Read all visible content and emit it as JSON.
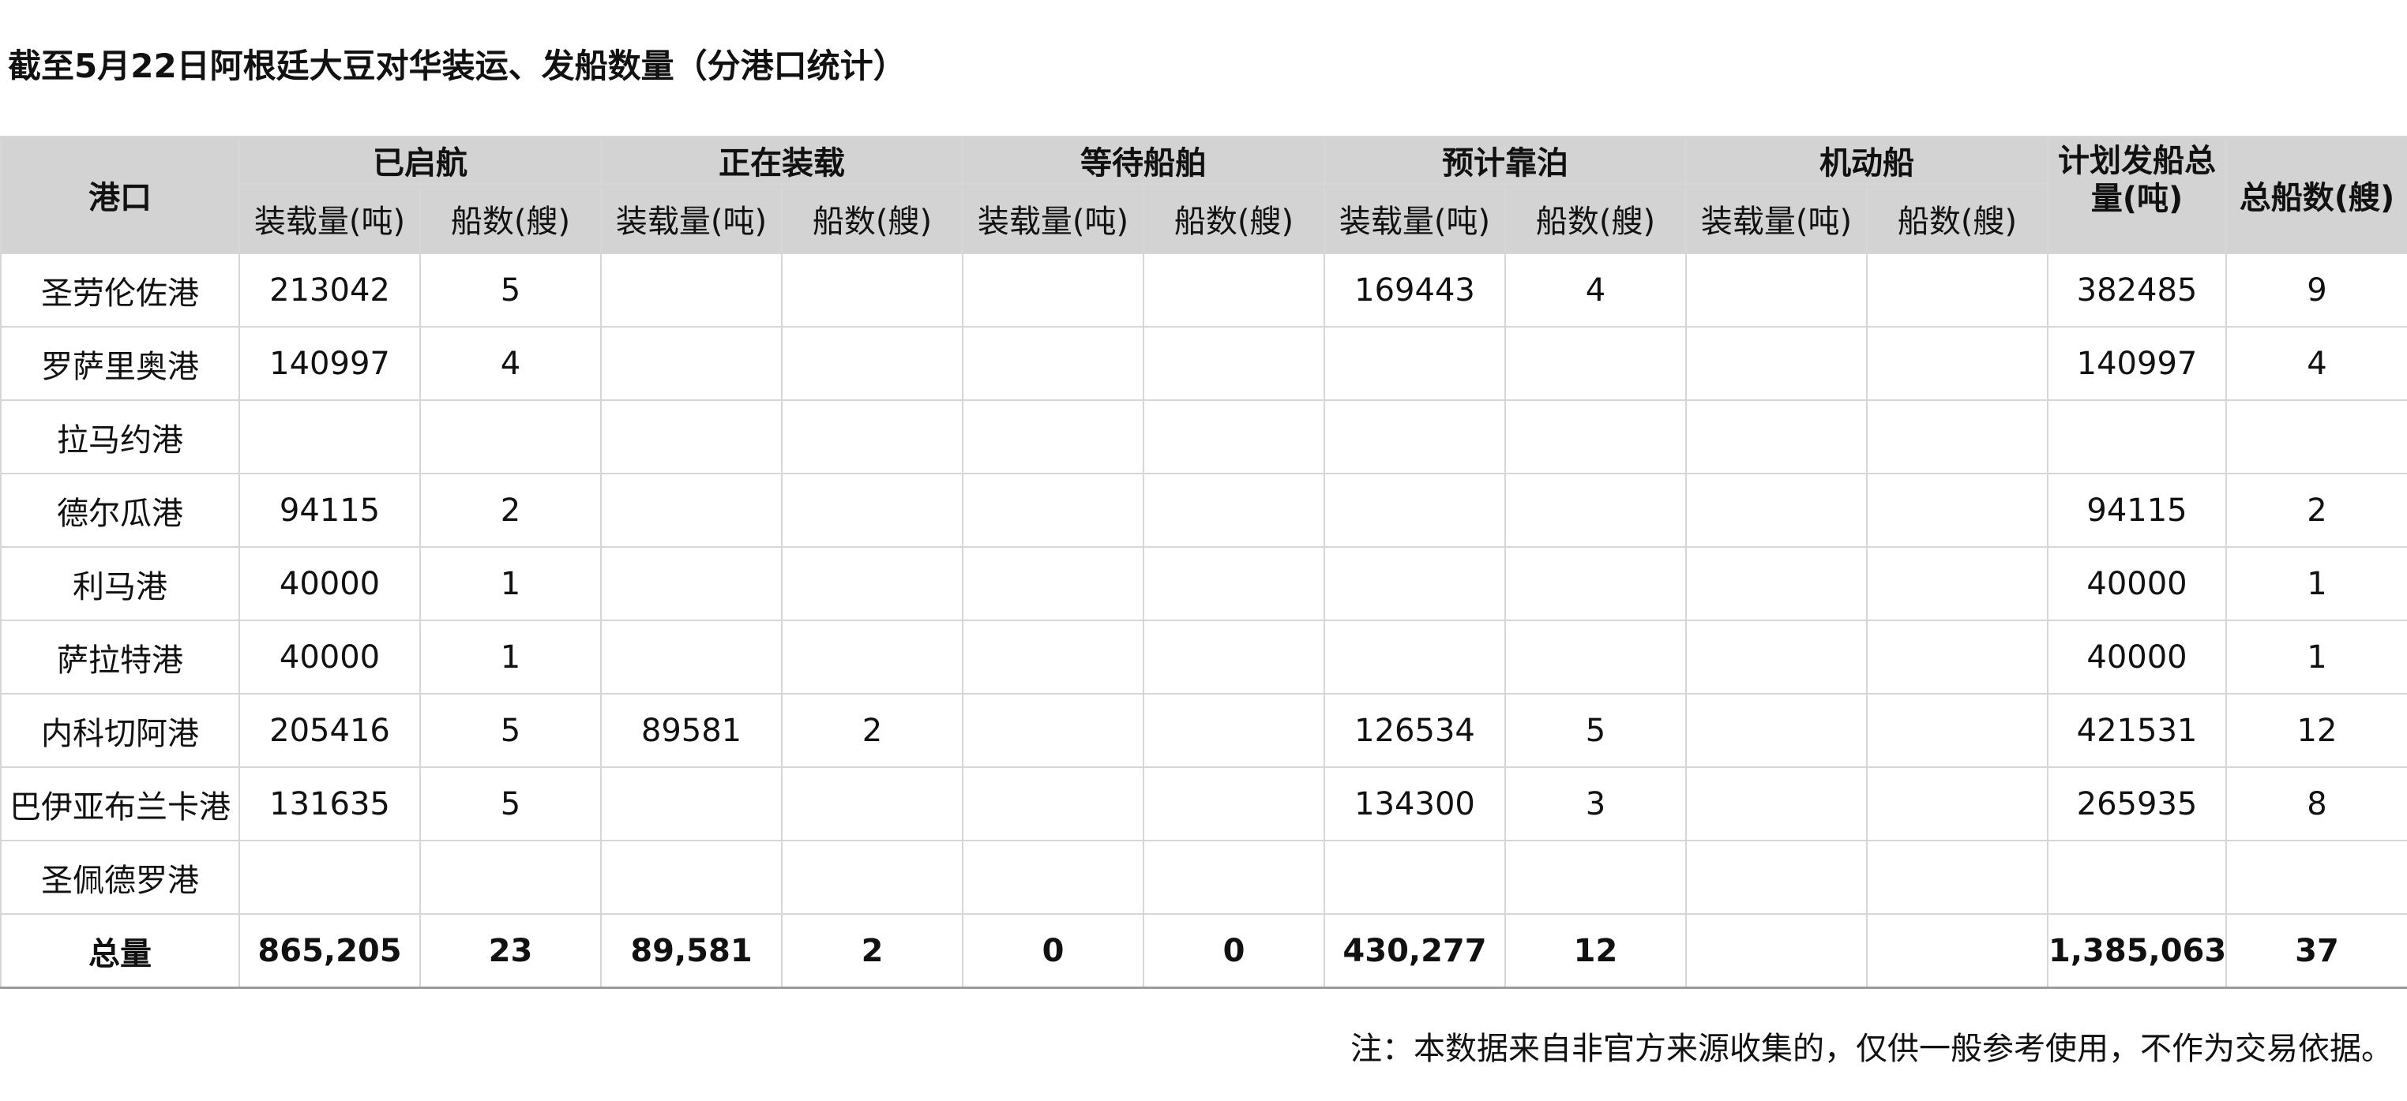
{
  "title": "截至5月22日阿根廷大豆对华装运、发船数量（分港口统计）",
  "headers": {
    "port": "港口",
    "groups": [
      "已启航",
      "正在装载",
      "等待船舶",
      "预计靠泊",
      "机动船"
    ],
    "planned": "计划发船总量(吨)",
    "total_ships": "总船数(艘)",
    "sub_tons": "装载量(吨)",
    "sub_ships": "船数(艘)"
  },
  "rows": [
    {
      "port": "圣劳伦佐港",
      "c": [
        "213042",
        "5",
        "",
        "",
        "",
        "",
        "169443",
        "4",
        "",
        "",
        "382485",
        "9"
      ]
    },
    {
      "port": "罗萨里奥港",
      "c": [
        "140997",
        "4",
        "",
        "",
        "",
        "",
        "",
        "",
        "",
        "",
        "140997",
        "4"
      ]
    },
    {
      "port": "拉马约港",
      "c": [
        "",
        "",
        "",
        "",
        "",
        "",
        "",
        "",
        "",
        "",
        "",
        ""
      ]
    },
    {
      "port": "德尔瓜港",
      "c": [
        "94115",
        "2",
        "",
        "",
        "",
        "",
        "",
        "",
        "",
        "",
        "94115",
        "2"
      ]
    },
    {
      "port": "利马港",
      "c": [
        "40000",
        "1",
        "",
        "",
        "",
        "",
        "",
        "",
        "",
        "",
        "40000",
        "1"
      ]
    },
    {
      "port": "萨拉特港",
      "c": [
        "40000",
        "1",
        "",
        "",
        "",
        "",
        "",
        "",
        "",
        "",
        "40000",
        "1"
      ]
    },
    {
      "port": "内科切阿港",
      "c": [
        "205416",
        "5",
        "89581",
        "2",
        "",
        "",
        "126534",
        "5",
        "",
        "",
        "421531",
        "12"
      ]
    },
    {
      "port": "巴伊亚布兰卡港",
      "c": [
        "131635",
        "5",
        "",
        "",
        "",
        "",
        "134300",
        "3",
        "",
        "",
        "265935",
        "8"
      ]
    },
    {
      "port": "圣佩德罗港",
      "c": [
        "",
        "",
        "",
        "",
        "",
        "",
        "",
        "",
        "",
        "",
        "",
        ""
      ]
    }
  ],
  "total": {
    "port": "总量",
    "c": [
      "865,205",
      "23",
      "89,581",
      "2",
      "0",
      "0",
      "430,277",
      "12",
      "",
      "",
      "1,385,063",
      "37"
    ]
  },
  "note": "注：本数据来自非官方来源收集的，仅供一般参考使用，不作为交易依据。"
}
